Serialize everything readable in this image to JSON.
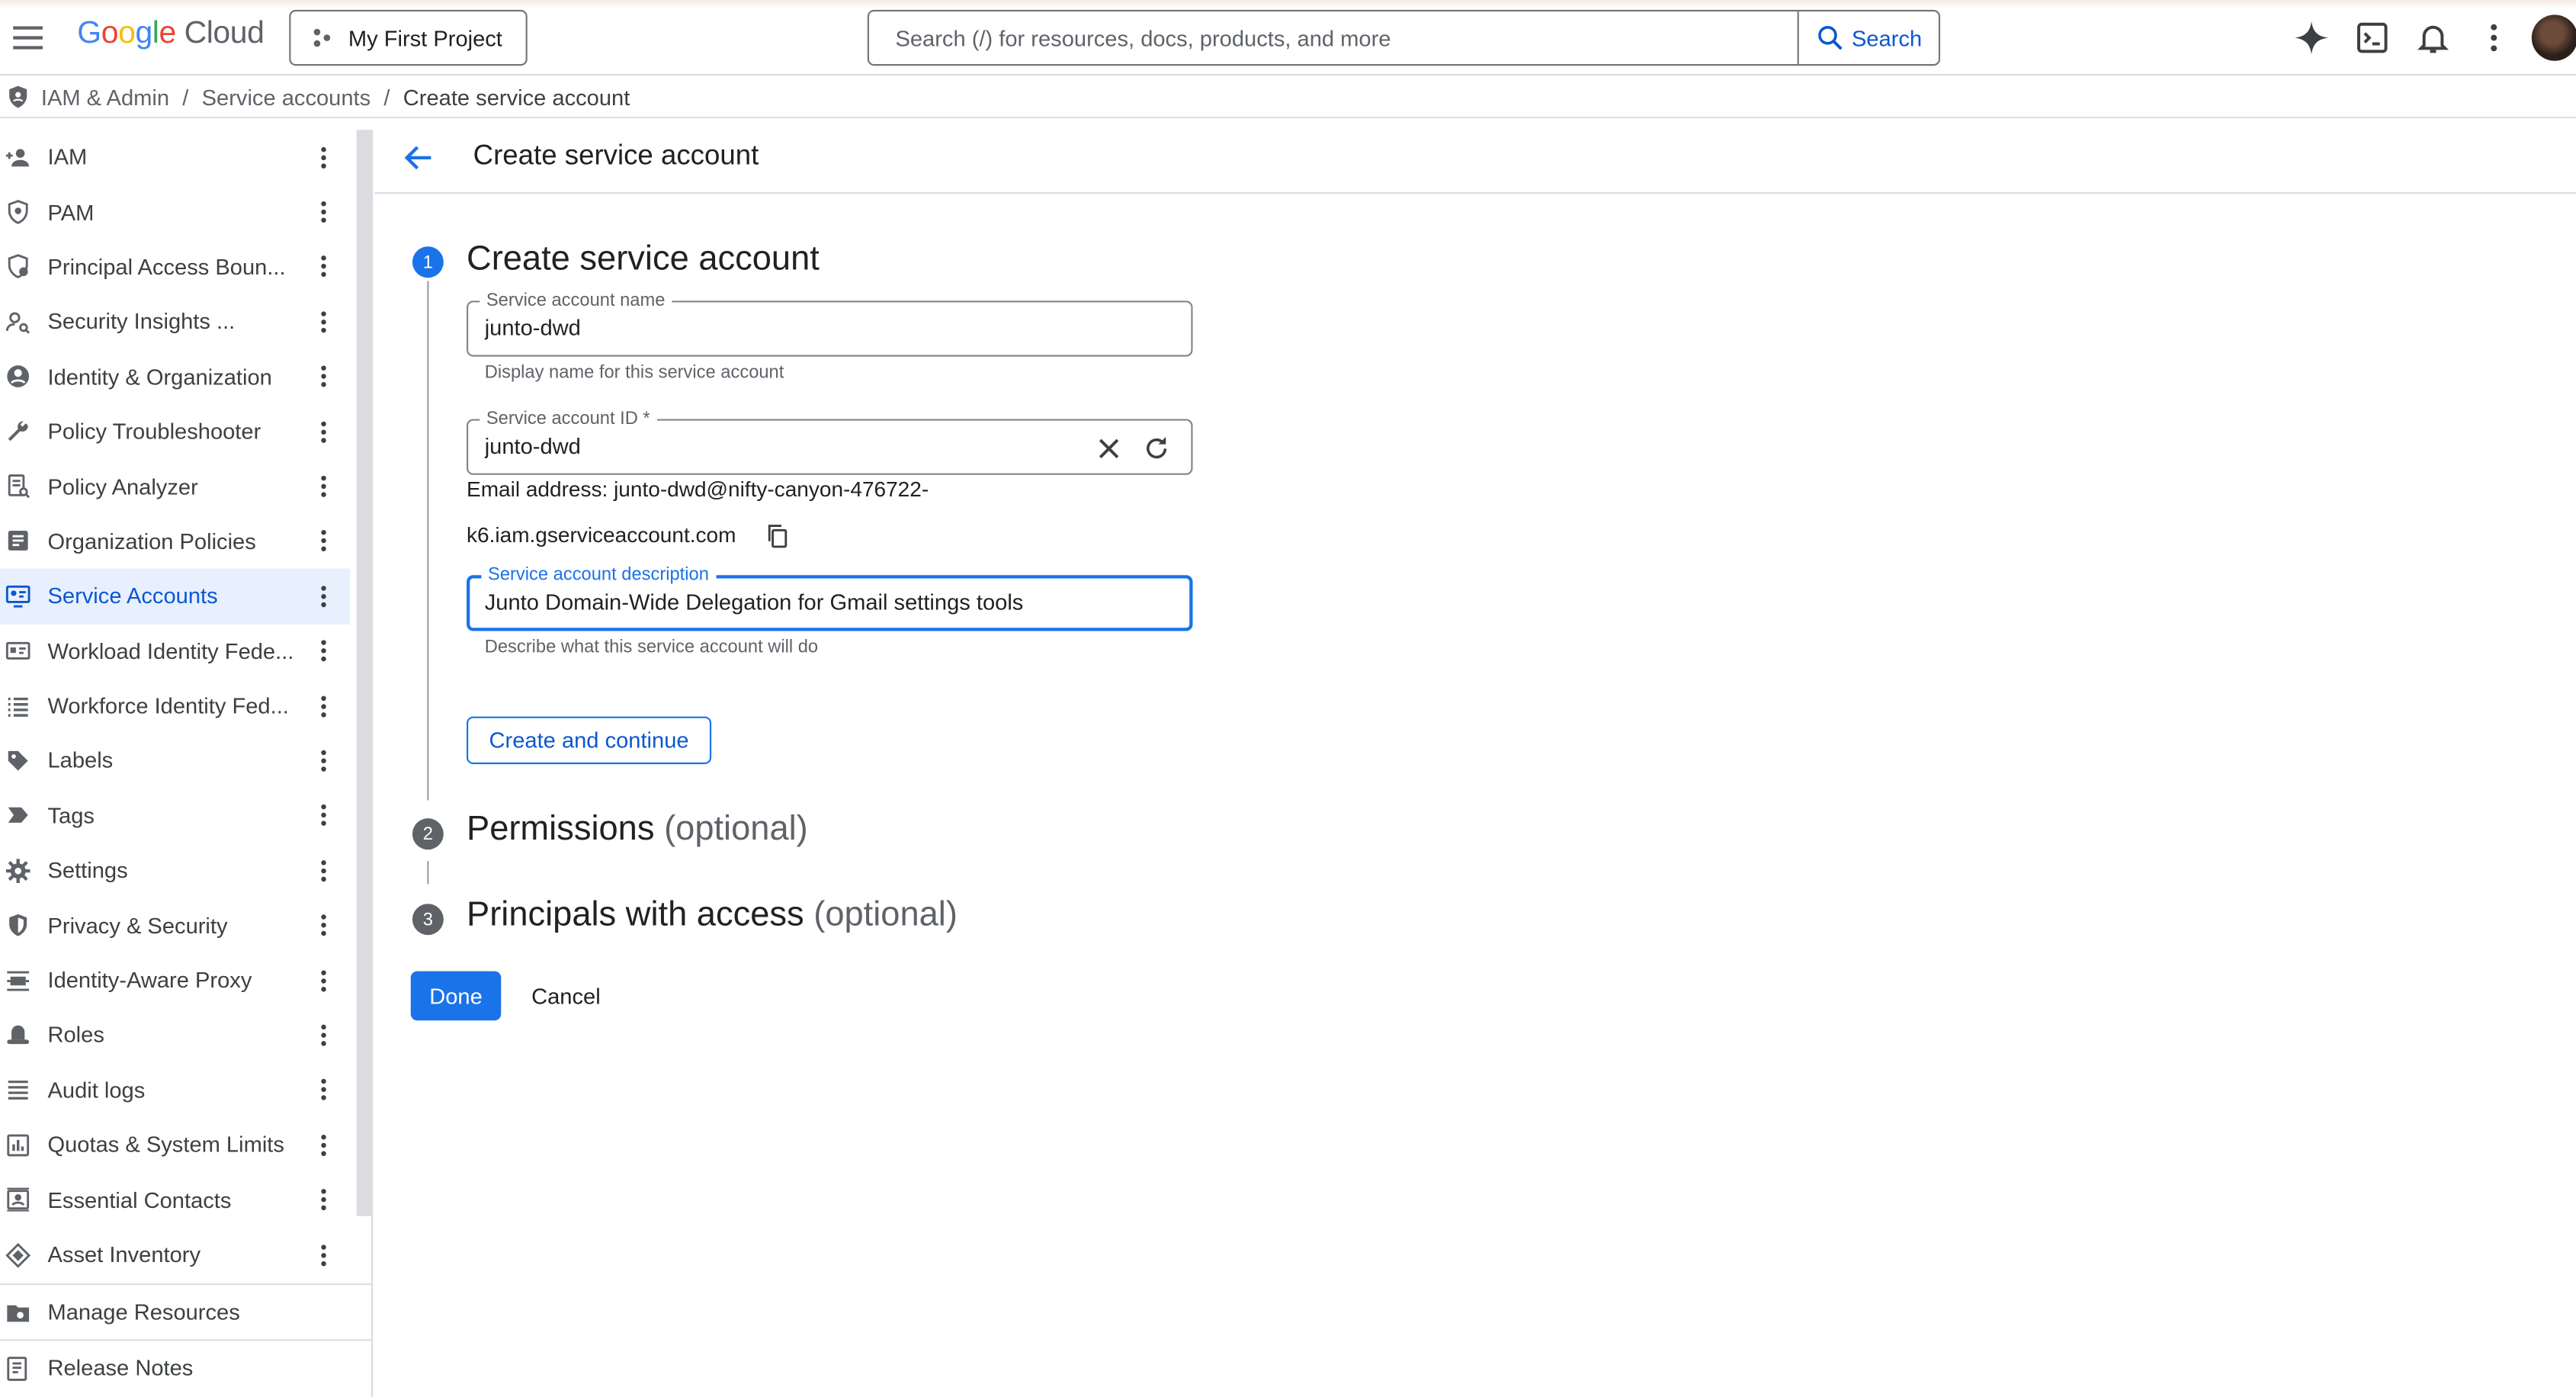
{
  "header": {
    "logo_google": [
      "G",
      "o",
      "o",
      "g",
      "l",
      "e"
    ],
    "logo_product": "Cloud",
    "project_label": "My First Project",
    "search_placeholder": "Search (/) for resources, docs, products, and more",
    "search_button": "Search",
    "icons": [
      "menu-icon",
      "project-icon",
      "search-icon",
      "gemini-sparkle-icon",
      "cloud-shell-icon",
      "notifications-icon",
      "more-vert-icon",
      "avatar"
    ]
  },
  "breadcrumb": {
    "items": [
      "IAM & Admin",
      "Service accounts",
      "Create service account"
    ],
    "separator": "/"
  },
  "sidebar": {
    "items": [
      {
        "label": "IAM",
        "icon": "person-add-icon"
      },
      {
        "label": "PAM",
        "icon": "shield-icon"
      },
      {
        "label": "Principal Access Boun...",
        "icon": "access-boundary-icon"
      },
      {
        "label": "Security Insights ...",
        "icon": "security-insights-icon"
      },
      {
        "label": "Identity & Organization",
        "icon": "account-circle-icon"
      },
      {
        "label": "Policy Troubleshooter",
        "icon": "wrench-icon"
      },
      {
        "label": "Policy Analyzer",
        "icon": "policy-analyzer-icon"
      },
      {
        "label": "Organization Policies",
        "icon": "list-box-icon"
      },
      {
        "label": "Service Accounts",
        "icon": "service-account-icon",
        "active": true
      },
      {
        "label": "Workload Identity Fede...",
        "icon": "id-card-icon"
      },
      {
        "label": "Workforce Identity Fed...",
        "icon": "list-icon"
      },
      {
        "label": "Labels",
        "icon": "label-icon"
      },
      {
        "label": "Tags",
        "icon": "tag-icon"
      },
      {
        "label": "Settings",
        "icon": "settings-icon"
      },
      {
        "label": "Privacy & Security",
        "icon": "privacy-shield-icon"
      },
      {
        "label": "Identity-Aware Proxy",
        "icon": "proxy-icon"
      },
      {
        "label": "Roles",
        "icon": "roles-hat-icon"
      },
      {
        "label": "Audit logs",
        "icon": "lines-icon"
      },
      {
        "label": "Quotas & System Limits",
        "icon": "quota-icon"
      },
      {
        "label": "Essential Contacts",
        "icon": "contacts-icon"
      },
      {
        "label": "Asset Inventory",
        "icon": "inventory-icon"
      }
    ],
    "footer": [
      {
        "label": "Manage Resources",
        "icon": "manage-resources-icon"
      },
      {
        "label": "Release Notes",
        "icon": "release-notes-icon"
      }
    ]
  },
  "main": {
    "page_title": "Create service account",
    "steps": [
      {
        "number": "1",
        "title": "Create service account",
        "optional": ""
      },
      {
        "number": "2",
        "title": "Permissions",
        "optional": "(optional)"
      },
      {
        "number": "3",
        "title": "Principals with access",
        "optional": "(optional)"
      }
    ],
    "form": {
      "name_label": "Service account name",
      "name_value": "junto-dwd",
      "name_hint": "Display name for this service account",
      "id_label": "Service account ID *",
      "id_value": "junto-dwd",
      "email_line1": "Email address: junto-dwd@nifty-canyon-476722-",
      "email_line2": "k6.iam.gserviceaccount.com",
      "desc_label": "Service account description",
      "desc_value": "Junto Domain-Wide Delegation for Gmail settings tools",
      "desc_hint": "Describe what this service account will do",
      "create_button": "Create and continue"
    },
    "done_button": "Done",
    "cancel_button": "Cancel"
  },
  "colors": {
    "accent": "#1a73e8",
    "link": "#0b57d0",
    "active_nav_bg": "#e8f0fe",
    "step_inactive": "#5f6368"
  }
}
